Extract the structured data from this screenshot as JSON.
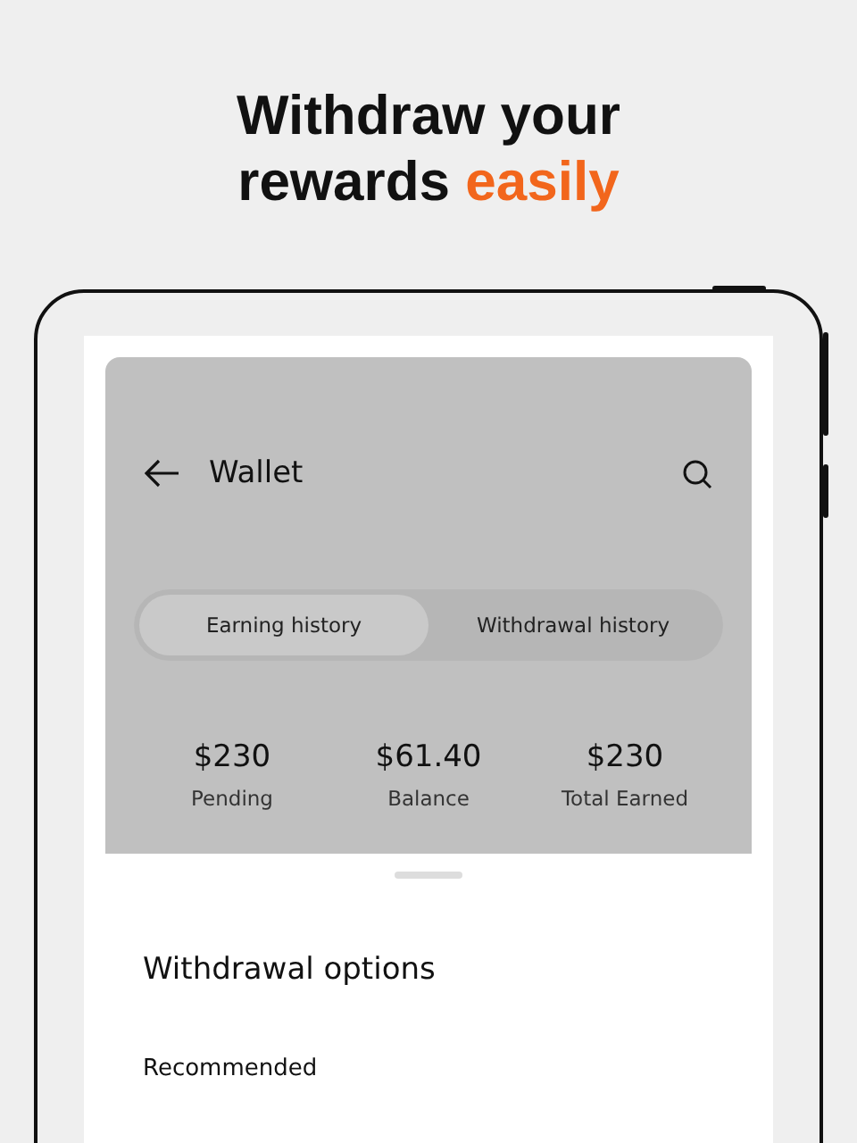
{
  "headline": [
    {
      "text": "Withdraw your rewards",
      "accent": false
    },
    {
      "text": "easily",
      "accent": true
    }
  ],
  "screen": {
    "title": "Wallet",
    "tabs": [
      {
        "label": "Earning history",
        "selected": true
      },
      {
        "label": "Withdrawal history",
        "selected": false
      }
    ],
    "stats": [
      {
        "value": "$230",
        "label": "Pending"
      },
      {
        "value": "$61.40",
        "label": "Balance"
      },
      {
        "value": "$230",
        "label": "Total Earned"
      }
    ],
    "sheet": {
      "title": "Withdrawal options",
      "section": "Recommended"
    }
  }
}
